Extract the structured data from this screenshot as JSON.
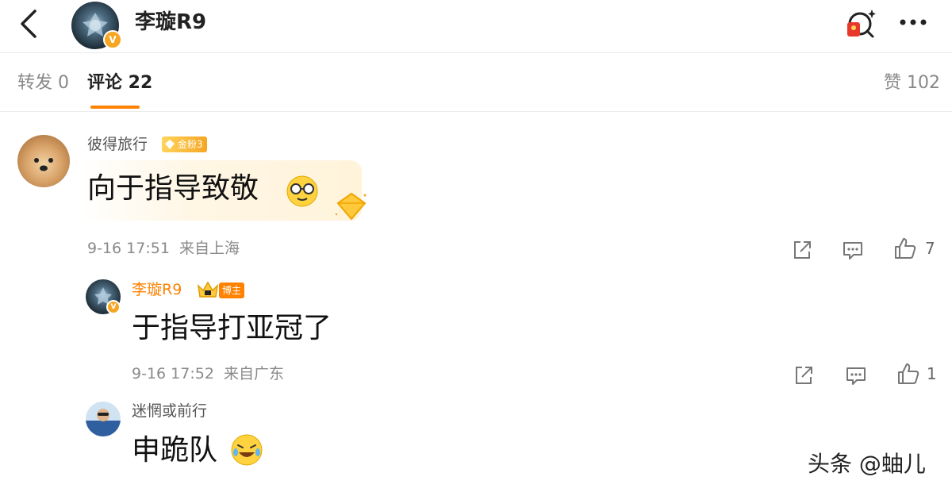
{
  "header": {
    "title": "李璇R9",
    "avatar_badge": "V",
    "icons": [
      "back-arrow-icon",
      "search-redpacket-icon",
      "more-icon"
    ]
  },
  "tabs": {
    "repost": "转发 0",
    "comments": "评论 22",
    "likes": "赞 102"
  },
  "comments": [
    {
      "user": "彼得旅行",
      "badge": "金粉3",
      "text": "向于指导致敬",
      "emoji": "glasses-face-emoji",
      "time": "9-16 17:51",
      "location": "来自上海",
      "likes": "7"
    },
    {
      "user": "李璇R9",
      "badge": "博主",
      "text": "于指导打亚冠了",
      "time": "9-16 17:52",
      "location": "来自广东",
      "likes": "1"
    },
    {
      "user": "迷惘或前行",
      "text": "申跪队",
      "emoji": "laughing-crying-emoji"
    }
  ],
  "watermark": "头条 @蚰儿",
  "colors": {
    "accent": "#ff8200",
    "gold": "#f5a623"
  }
}
